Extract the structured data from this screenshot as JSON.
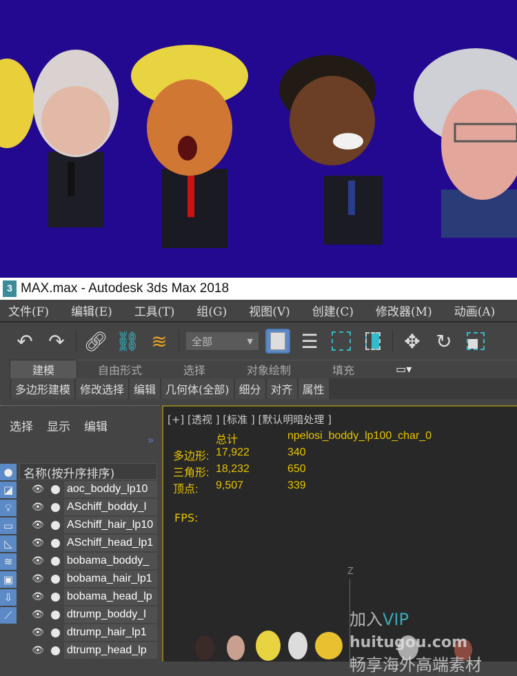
{
  "window": {
    "title": "MAX.max - Autodesk 3ds Max 2018",
    "app_icon": "3ds-max-logo"
  },
  "menu": [
    "文件(F)",
    "编辑(E)",
    "工具(T)",
    "组(G)",
    "视图(V)",
    "创建(C)",
    "修改器(M)",
    "动画(A)"
  ],
  "toolbar": {
    "selection_filter": "全部",
    "icons": [
      "undo-icon",
      "redo-icon",
      "link-icon",
      "unlink-icon",
      "bind-spacewarp-icon",
      "select-object-icon",
      "select-by-name-icon",
      "rect-selection-icon",
      "window-crossing-icon",
      "move-icon",
      "rotate-icon",
      "scale-icon"
    ]
  },
  "ribbon": {
    "tabs": [
      "建模",
      "自由形式",
      "选择",
      "对象绘制",
      "填充"
    ],
    "subtabs": [
      "多边形建模",
      "修改选择",
      "编辑",
      "几何体(全部)",
      "细分",
      "对齐",
      "属性"
    ]
  },
  "scene_explorer": {
    "tabs": [
      "选择",
      "显示",
      "编辑"
    ],
    "column_header": "名称(按升序排序)",
    "items": [
      "aoc_boddy_lp10",
      "ASchiff_boddy_l",
      "ASchiff_hair_lp10",
      "ASchiff_head_lp1",
      "bobama_boddy_",
      "bobama_hair_lp1",
      "bobama_head_lp",
      "dtrump_boddy_l",
      "dtrump_hair_lp1",
      "dtrump_head_lp"
    ]
  },
  "viewport": {
    "label": "[+] [透视 ] [标准 ] [默认明暗处理 ]",
    "stats": {
      "header_total": "总计",
      "header_object": "npelosi_boddy_lp100_char_0",
      "rows": [
        {
          "label": "多边形:",
          "total": "17,922",
          "object": "340"
        },
        {
          "label": "三角形:",
          "total": "18,232",
          "object": "650"
        },
        {
          "label": "顶点:",
          "total": "9,507",
          "object": "339"
        }
      ]
    },
    "fps_label": "FPS:",
    "axis_label": "Z"
  },
  "watermark": {
    "line1a": "加入",
    "line1b": "VIP",
    "brand": "huitugou.com",
    "line2": "畅享海外高端素材"
  },
  "colors": {
    "render_bg": "#23098f",
    "stats_text": "#e8c400",
    "accent": "#5b8ac7"
  }
}
